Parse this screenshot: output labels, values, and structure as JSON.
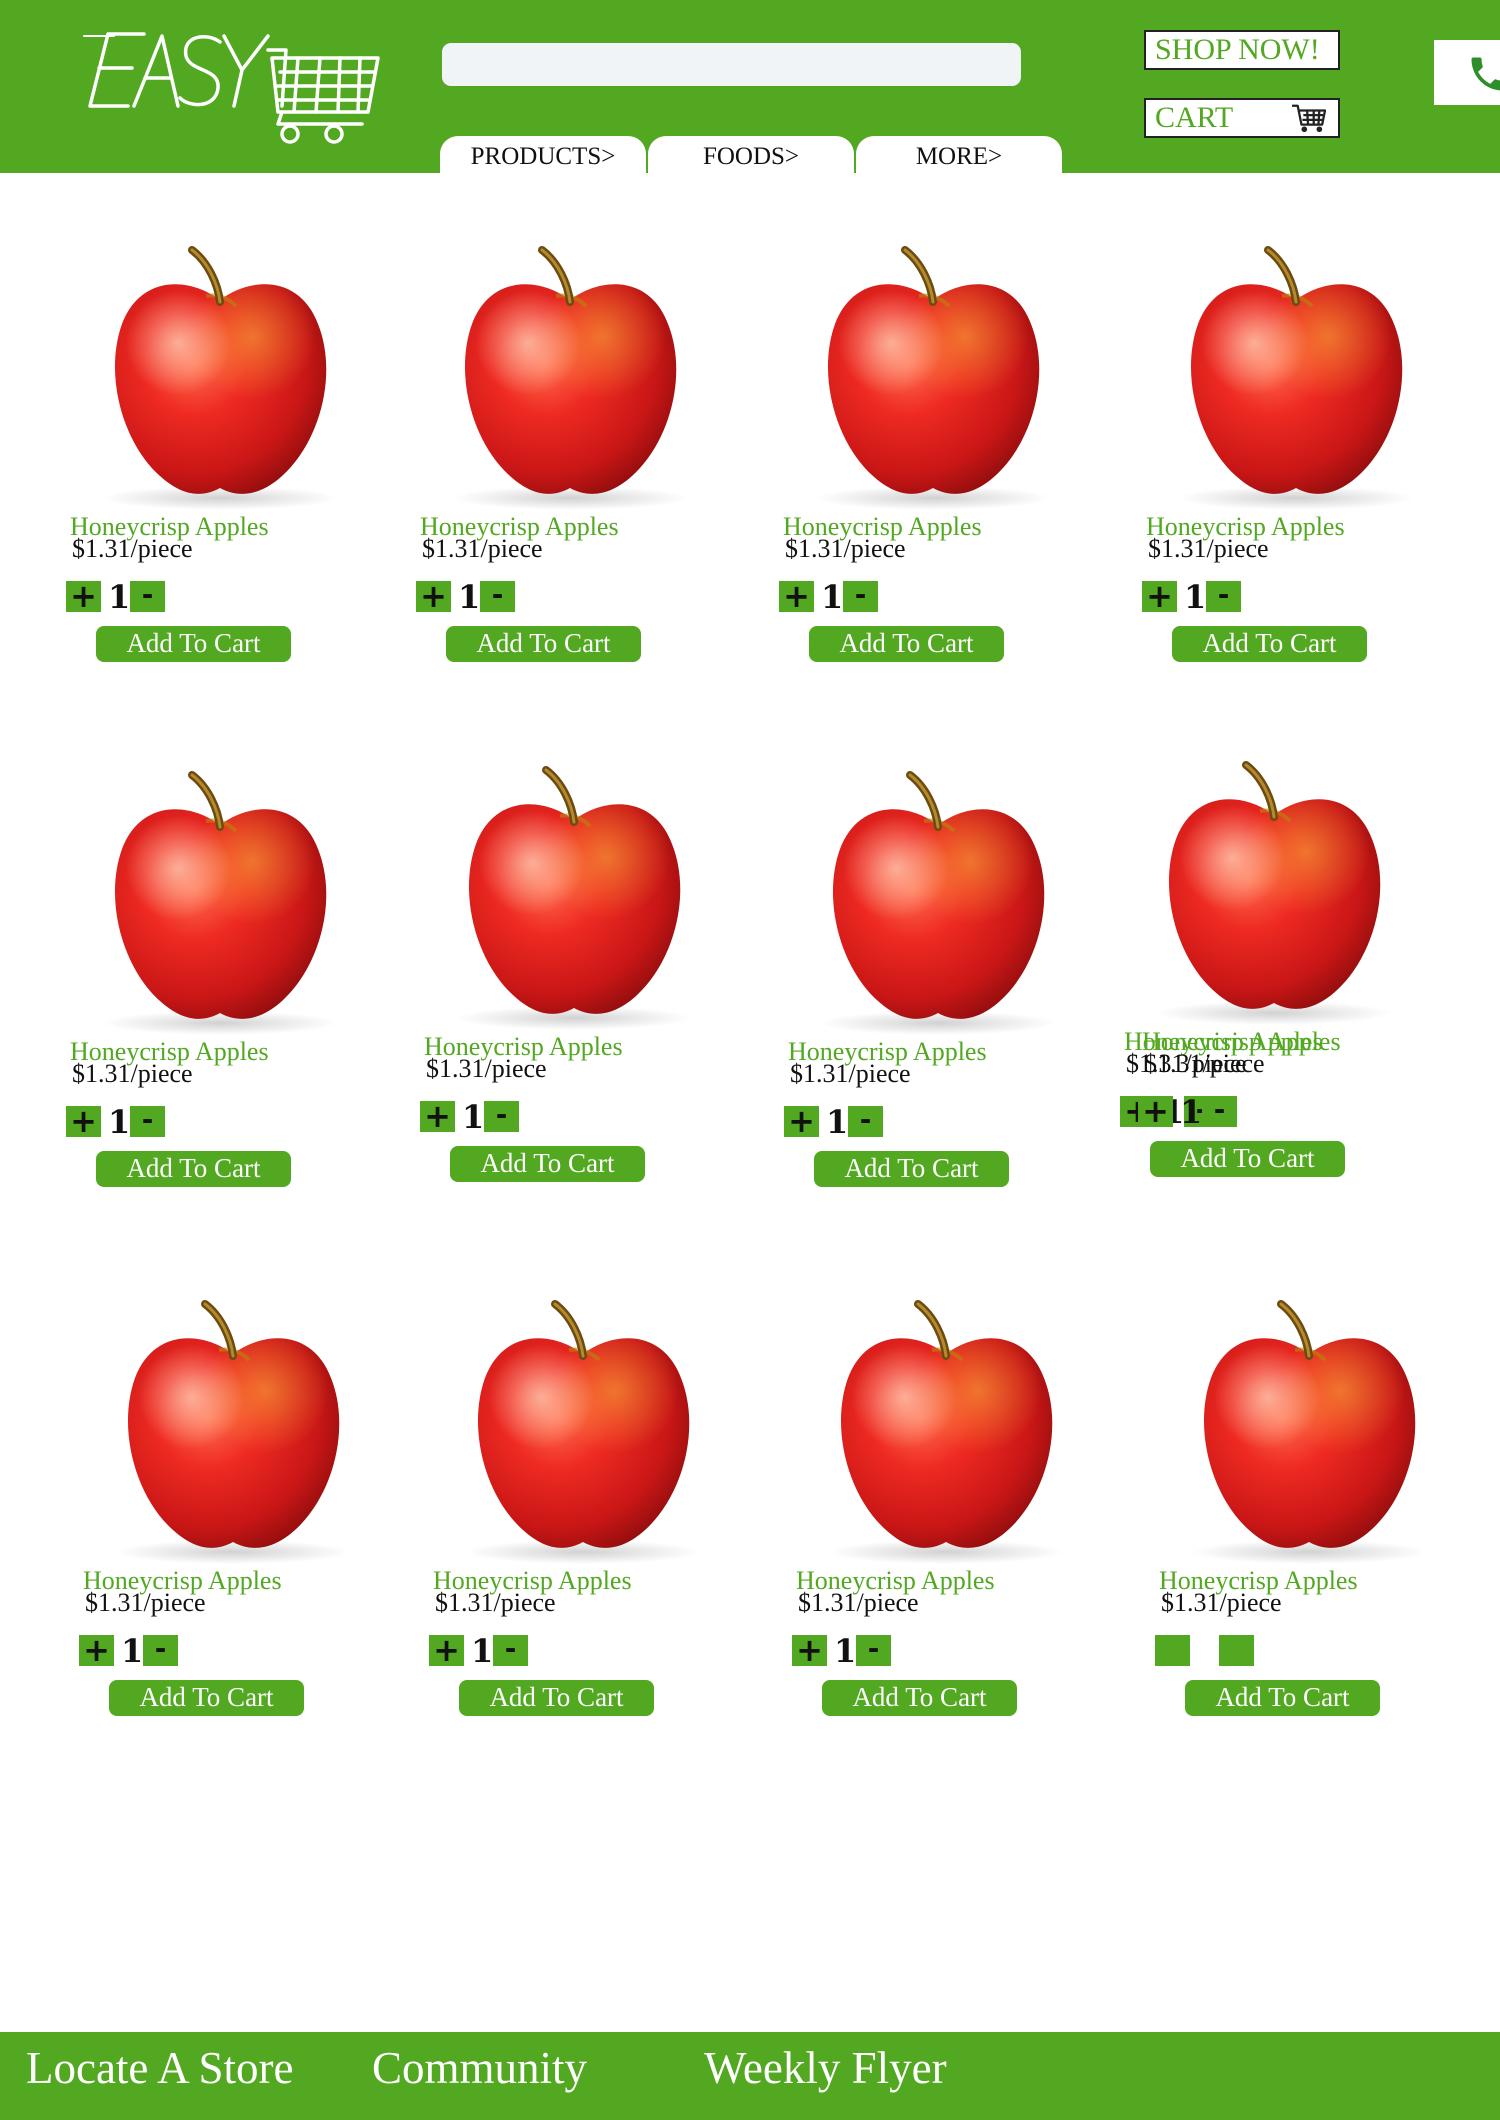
{
  "header": {
    "logo_text": "EASY",
    "search": {
      "value": "",
      "placeholder": ""
    },
    "tabs": [
      {
        "label": "PRODUCTS>"
      },
      {
        "label": "FOODS>"
      },
      {
        "label": "MORE>"
      }
    ],
    "shop_now_label": "SHOP NOW!",
    "cart_label": "CART",
    "cart_icon": "shopping-cart-icon",
    "phone_icon": "phone-icon"
  },
  "products": [
    {
      "name": "Honeycrisp Apples",
      "price": "$1.31/piece",
      "qty": "1",
      "plus": "+",
      "minus": "-",
      "add_label": "Add To Cart"
    },
    {
      "name": "Honeycrisp Apples",
      "price": "$1.31/piece",
      "qty": "1",
      "plus": "+",
      "minus": "-",
      "add_label": "Add To Cart"
    },
    {
      "name": "Honeycrisp Apples",
      "price": "$1.31/piece",
      "qty": "1",
      "plus": "+",
      "minus": "-",
      "add_label": "Add To Cart"
    },
    {
      "name": "Honeycrisp Apples",
      "price": "$1.31/piece",
      "qty": "1",
      "plus": "+",
      "minus": "-",
      "add_label": "Add To Cart"
    },
    {
      "name": "Honeycrisp Apples",
      "price": "$1.31/piece",
      "qty": "1",
      "plus": "+",
      "minus": "-",
      "add_label": "Add To Cart"
    },
    {
      "name": "Honeycrisp Apples",
      "price": "$1.31/piece",
      "qty": "1",
      "plus": "+",
      "minus": "-",
      "add_label": "Add To Cart"
    },
    {
      "name": "Honeycrisp Apples",
      "price": "$1.31/piece",
      "qty": "1",
      "plus": "+",
      "minus": "-",
      "add_label": "Add To Cart"
    },
    {
      "name": "Honeycrisp Apples",
      "price": "$1.31/piece",
      "qty": "1",
      "plus": "+",
      "minus": "-",
      "add_label": "Add To Cart"
    },
    {
      "name": "Honeycrisp Apples",
      "price": "$1.31/piece",
      "qty": "1",
      "plus": "+",
      "minus": "-",
      "add_label": "Add To Cart"
    },
    {
      "name": "Honeycrisp Apples",
      "price": "$1.31/piece",
      "qty": "1",
      "plus": "+",
      "minus": "-",
      "add_label": "Add To Cart"
    },
    {
      "name": "Honeycrisp Apples",
      "price": "$1.31/piece",
      "qty": "1",
      "plus": "+",
      "minus": "-",
      "add_label": "Add To Cart"
    },
    {
      "name": "Honeycrisp Apples",
      "price": "$1.31/piece",
      "qty": "",
      "plus": "",
      "minus": "",
      "add_label": "Add To Cart"
    }
  ],
  "product_image_icon": "apple-image",
  "footer": {
    "links": [
      {
        "label": "Locate A Store"
      },
      {
        "label": "Community"
      },
      {
        "label": "Weekly Flyer"
      }
    ]
  },
  "colors": {
    "brand_green": "#52a820",
    "search_bg": "#f1f4f7",
    "text": "#111111"
  }
}
